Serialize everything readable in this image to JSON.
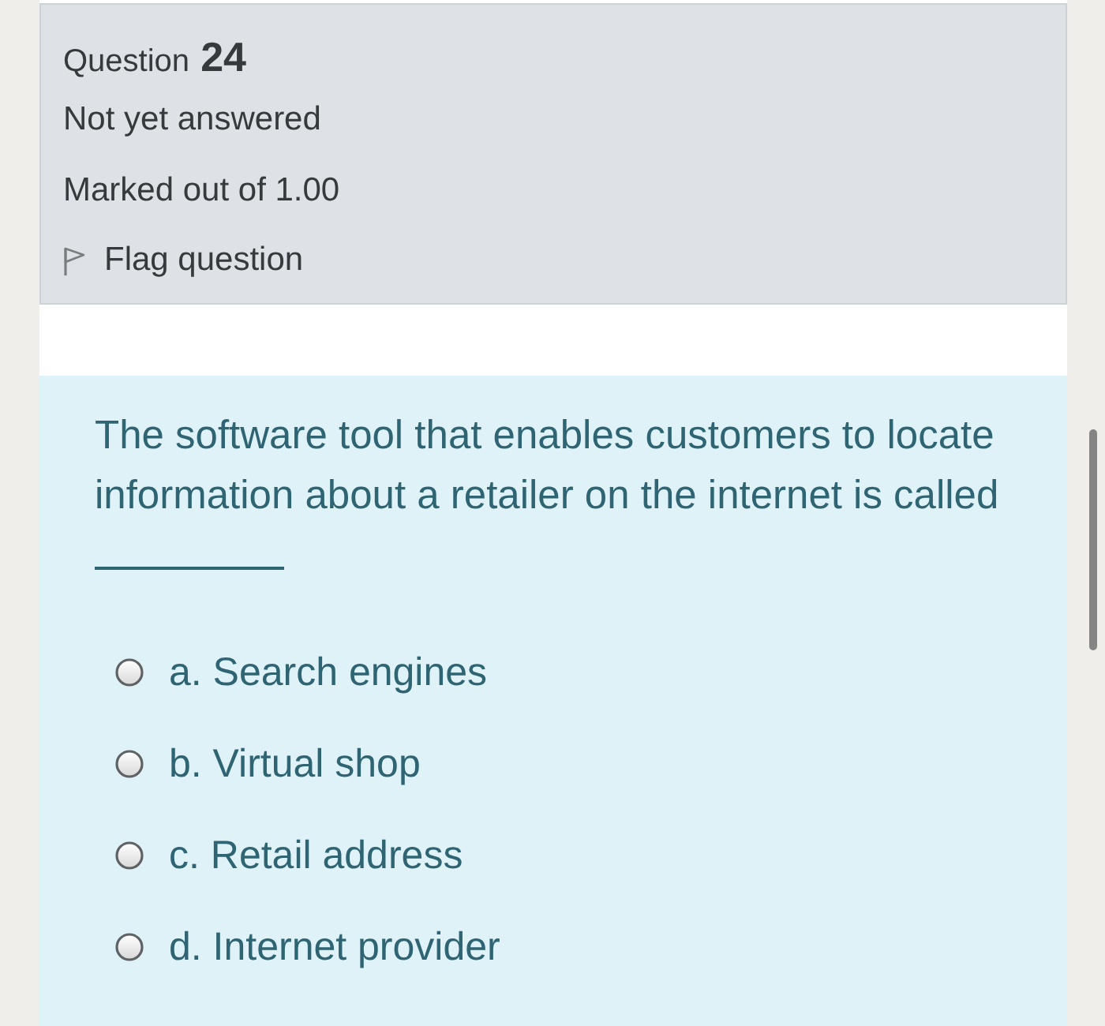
{
  "question": {
    "label": "Question",
    "number": "24",
    "status": "Not yet answered",
    "marks": "Marked out of 1.00",
    "flag": {
      "label": "Flag question",
      "flagged": false
    }
  },
  "prompt": {
    "text": "The software tool that enables customers to locate information about a retailer on the internet is called"
  },
  "options": [
    {
      "label": "a. Search engines",
      "selected": false
    },
    {
      "label": "b. Virtual shop",
      "selected": false
    },
    {
      "label": "c. Retail address",
      "selected": false
    },
    {
      "label": "d. Internet provider",
      "selected": false
    }
  ]
}
